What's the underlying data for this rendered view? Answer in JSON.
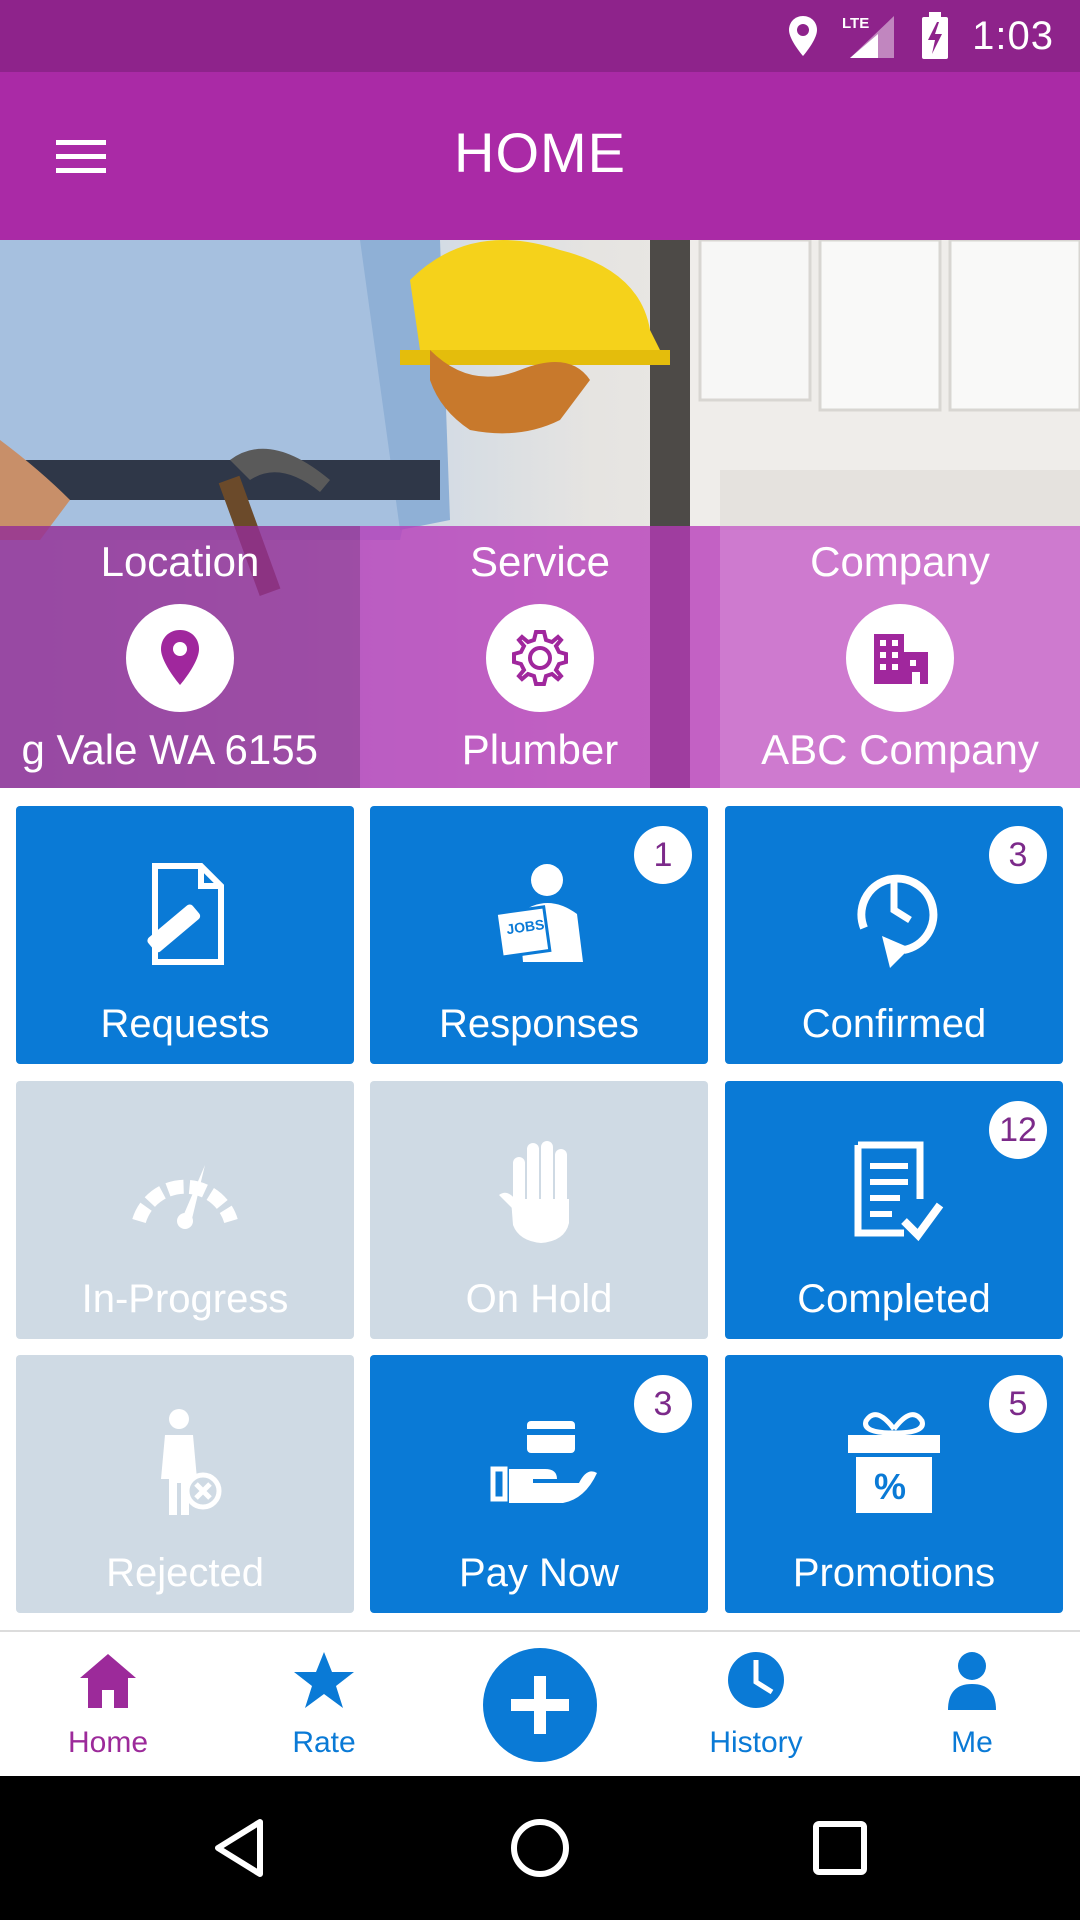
{
  "status_bar": {
    "time": "1:03",
    "network": "LTE"
  },
  "app_bar": {
    "title": "HOME"
  },
  "info": [
    {
      "label": "Location",
      "value": "g Vale WA 6155",
      "icon": "map-pin-icon"
    },
    {
      "label": "Service",
      "value": "Plumber",
      "icon": "gear-icon"
    },
    {
      "label": "Company",
      "value": "ABC Company",
      "icon": "building-icon"
    }
  ],
  "tiles": [
    {
      "label": "Requests",
      "badge": "",
      "icon": "document-edit-icon",
      "state": "active"
    },
    {
      "label": "Responses",
      "badge": "1",
      "icon": "jobs-person-icon",
      "state": "active"
    },
    {
      "label": "Confirmed",
      "badge": "3",
      "icon": "clock-arrow-icon",
      "state": "active"
    },
    {
      "label": "In-Progress",
      "badge": "",
      "icon": "speedometer-icon",
      "state": "disabled"
    },
    {
      "label": "On Hold",
      "badge": "",
      "icon": "hand-icon",
      "state": "disabled"
    },
    {
      "label": "Completed",
      "badge": "12",
      "icon": "checklist-icon",
      "state": "active"
    },
    {
      "label": "Rejected",
      "badge": "",
      "icon": "person-rejected-icon",
      "state": "disabled"
    },
    {
      "label": "Pay Now",
      "badge": "3",
      "icon": "card-hand-icon",
      "state": "active"
    },
    {
      "label": "Promotions",
      "badge": "5",
      "icon": "gift-percent-icon",
      "state": "active"
    }
  ],
  "bottom_nav": [
    {
      "label": "Home",
      "icon": "home-icon",
      "active": true
    },
    {
      "label": "Rate",
      "icon": "star-icon",
      "active": false
    },
    {
      "label": "History",
      "icon": "clock-icon",
      "active": false
    },
    {
      "label": "Me",
      "icon": "person-icon",
      "active": false
    }
  ],
  "colors": {
    "status_bar": "#8e238b",
    "app_bar": "#aa2aa6",
    "tile_active": "#0a7ad6",
    "tile_disabled": "#cfdae4",
    "nav_active": "#9c2a9a",
    "nav_inactive": "#0a7ad6",
    "badge_text": "#7c2a8a"
  }
}
